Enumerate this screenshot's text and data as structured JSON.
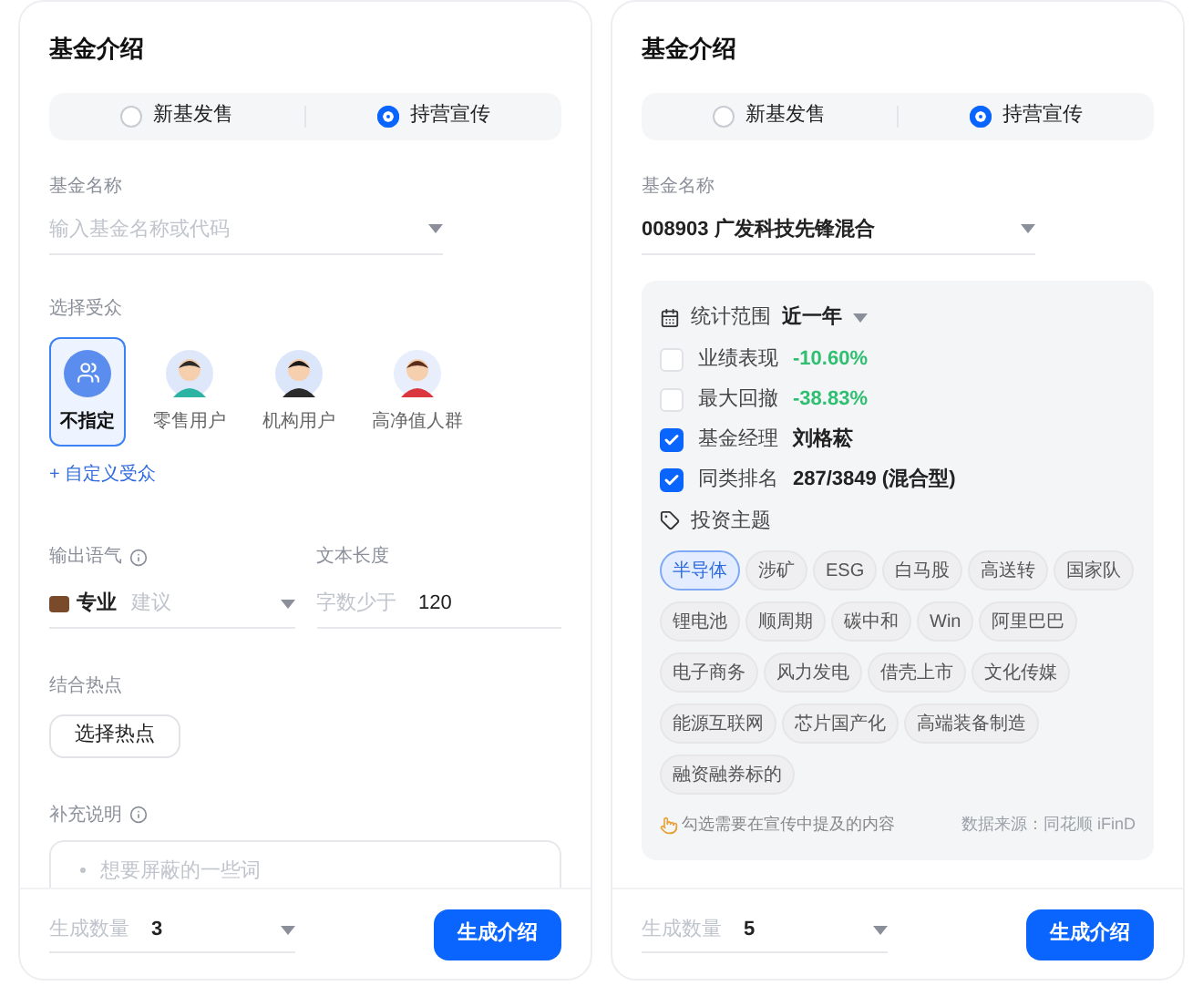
{
  "panels": [
    {
      "title": "基金介绍",
      "modes": [
        {
          "label": "新基发售",
          "selected": false
        },
        {
          "label": "持营宣传",
          "selected": true
        }
      ],
      "fund_field": {
        "label": "基金名称",
        "placeholder": "输入基金名称或代码"
      },
      "sections": [
        {
          "kind": "audience",
          "label": "选择受众",
          "options": [
            {
              "label": "不指定",
              "selected": true,
              "kind": "generic"
            },
            {
              "label": "零售用户",
              "selected": false,
              "kind": "avatar"
            },
            {
              "label": "机构用户",
              "selected": false,
              "kind": "avatar"
            },
            {
              "label": "高净值人群",
              "selected": false,
              "kind": "avatar"
            }
          ],
          "custom_link": "+ 自定义受众"
        },
        {
          "kind": "tone_length",
          "tone": {
            "label": "输出语气",
            "value": "专业",
            "placeholder": "建议"
          },
          "length": {
            "label": "文本长度",
            "prefix": "字数少于",
            "value": "120"
          }
        },
        {
          "kind": "hotspot",
          "label": "结合热点",
          "button": "选择热点"
        },
        {
          "kind": "note",
          "label": "补充说明",
          "lines": [
            "想要屏蔽的一些词"
          ]
        }
      ],
      "footer": {
        "count_label": "生成数量",
        "count_value": "3",
        "button": "生成介绍"
      }
    },
    {
      "title": "基金介绍",
      "modes": [
        {
          "label": "新基发售",
          "selected": false
        },
        {
          "label": "持营宣传",
          "selected": true
        }
      ],
      "fund_field": {
        "label": "基金名称",
        "value": "008903 广发科技先锋混合"
      },
      "sections": [
        {
          "kind": "stats",
          "range": {
            "label": "统计范围",
            "value": "近一年"
          },
          "items": [
            {
              "label": "业绩表现",
              "value": "-10.60%",
              "checked": false,
              "kind": "change"
            },
            {
              "label": "最大回撤",
              "value": "-38.83%",
              "checked": false,
              "kind": "change"
            },
            {
              "label": "基金经理",
              "value": "刘格菘",
              "checked": true,
              "kind": "text"
            },
            {
              "label": "同类排名",
              "value": "287/3849 (混合型)",
              "checked": true,
              "kind": "text"
            }
          ],
          "themes_label": "投资主题",
          "tags": [
            {
              "label": "半导体",
              "selected": true
            },
            {
              "label": "涉矿",
              "selected": false
            },
            {
              "label": "ESG",
              "selected": false
            },
            {
              "label": "白马股",
              "selected": false
            },
            {
              "label": "高送转",
              "selected": false
            },
            {
              "label": "国家队",
              "selected": false
            },
            {
              "label": "锂电池",
              "selected": false
            },
            {
              "label": "顺周期",
              "selected": false
            },
            {
              "label": "碳中和",
              "selected": false
            },
            {
              "label": "Win",
              "selected": false
            },
            {
              "label": "阿里巴巴",
              "selected": false
            },
            {
              "label": "电子商务",
              "selected": false
            },
            {
              "label": "风力发电",
              "selected": false
            },
            {
              "label": "借壳上市",
              "selected": false
            },
            {
              "label": "文化传媒",
              "selected": false
            },
            {
              "label": "能源互联网",
              "selected": false
            },
            {
              "label": "芯片国产化",
              "selected": false
            },
            {
              "label": "高端装备制造",
              "selected": false
            },
            {
              "label": "融资融券标的",
              "selected": false
            }
          ],
          "hint": "勾选需要在宣传中提及的内容",
          "source": "数据来源：同花顺 iFinD"
        }
      ],
      "footer": {
        "count_label": "生成数量",
        "count_value": "5",
        "button": "生成介绍"
      }
    }
  ]
}
